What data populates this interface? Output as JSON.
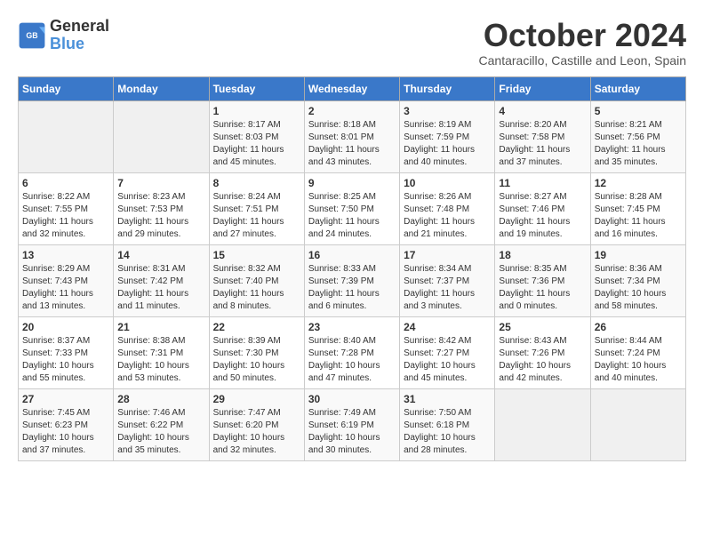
{
  "header": {
    "logo_line1": "General",
    "logo_line2": "Blue",
    "month_title": "October 2024",
    "location": "Cantaracillo, Castille and Leon, Spain"
  },
  "days_of_week": [
    "Sunday",
    "Monday",
    "Tuesday",
    "Wednesday",
    "Thursday",
    "Friday",
    "Saturday"
  ],
  "weeks": [
    [
      {
        "num": "",
        "info": ""
      },
      {
        "num": "",
        "info": ""
      },
      {
        "num": "1",
        "info": "Sunrise: 8:17 AM\nSunset: 8:03 PM\nDaylight: 11 hours and 45 minutes."
      },
      {
        "num": "2",
        "info": "Sunrise: 8:18 AM\nSunset: 8:01 PM\nDaylight: 11 hours and 43 minutes."
      },
      {
        "num": "3",
        "info": "Sunrise: 8:19 AM\nSunset: 7:59 PM\nDaylight: 11 hours and 40 minutes."
      },
      {
        "num": "4",
        "info": "Sunrise: 8:20 AM\nSunset: 7:58 PM\nDaylight: 11 hours and 37 minutes."
      },
      {
        "num": "5",
        "info": "Sunrise: 8:21 AM\nSunset: 7:56 PM\nDaylight: 11 hours and 35 minutes."
      }
    ],
    [
      {
        "num": "6",
        "info": "Sunrise: 8:22 AM\nSunset: 7:55 PM\nDaylight: 11 hours and 32 minutes."
      },
      {
        "num": "7",
        "info": "Sunrise: 8:23 AM\nSunset: 7:53 PM\nDaylight: 11 hours and 29 minutes."
      },
      {
        "num": "8",
        "info": "Sunrise: 8:24 AM\nSunset: 7:51 PM\nDaylight: 11 hours and 27 minutes."
      },
      {
        "num": "9",
        "info": "Sunrise: 8:25 AM\nSunset: 7:50 PM\nDaylight: 11 hours and 24 minutes."
      },
      {
        "num": "10",
        "info": "Sunrise: 8:26 AM\nSunset: 7:48 PM\nDaylight: 11 hours and 21 minutes."
      },
      {
        "num": "11",
        "info": "Sunrise: 8:27 AM\nSunset: 7:46 PM\nDaylight: 11 hours and 19 minutes."
      },
      {
        "num": "12",
        "info": "Sunrise: 8:28 AM\nSunset: 7:45 PM\nDaylight: 11 hours and 16 minutes."
      }
    ],
    [
      {
        "num": "13",
        "info": "Sunrise: 8:29 AM\nSunset: 7:43 PM\nDaylight: 11 hours and 13 minutes."
      },
      {
        "num": "14",
        "info": "Sunrise: 8:31 AM\nSunset: 7:42 PM\nDaylight: 11 hours and 11 minutes."
      },
      {
        "num": "15",
        "info": "Sunrise: 8:32 AM\nSunset: 7:40 PM\nDaylight: 11 hours and 8 minutes."
      },
      {
        "num": "16",
        "info": "Sunrise: 8:33 AM\nSunset: 7:39 PM\nDaylight: 11 hours and 6 minutes."
      },
      {
        "num": "17",
        "info": "Sunrise: 8:34 AM\nSunset: 7:37 PM\nDaylight: 11 hours and 3 minutes."
      },
      {
        "num": "18",
        "info": "Sunrise: 8:35 AM\nSunset: 7:36 PM\nDaylight: 11 hours and 0 minutes."
      },
      {
        "num": "19",
        "info": "Sunrise: 8:36 AM\nSunset: 7:34 PM\nDaylight: 10 hours and 58 minutes."
      }
    ],
    [
      {
        "num": "20",
        "info": "Sunrise: 8:37 AM\nSunset: 7:33 PM\nDaylight: 10 hours and 55 minutes."
      },
      {
        "num": "21",
        "info": "Sunrise: 8:38 AM\nSunset: 7:31 PM\nDaylight: 10 hours and 53 minutes."
      },
      {
        "num": "22",
        "info": "Sunrise: 8:39 AM\nSunset: 7:30 PM\nDaylight: 10 hours and 50 minutes."
      },
      {
        "num": "23",
        "info": "Sunrise: 8:40 AM\nSunset: 7:28 PM\nDaylight: 10 hours and 47 minutes."
      },
      {
        "num": "24",
        "info": "Sunrise: 8:42 AM\nSunset: 7:27 PM\nDaylight: 10 hours and 45 minutes."
      },
      {
        "num": "25",
        "info": "Sunrise: 8:43 AM\nSunset: 7:26 PM\nDaylight: 10 hours and 42 minutes."
      },
      {
        "num": "26",
        "info": "Sunrise: 8:44 AM\nSunset: 7:24 PM\nDaylight: 10 hours and 40 minutes."
      }
    ],
    [
      {
        "num": "27",
        "info": "Sunrise: 7:45 AM\nSunset: 6:23 PM\nDaylight: 10 hours and 37 minutes."
      },
      {
        "num": "28",
        "info": "Sunrise: 7:46 AM\nSunset: 6:22 PM\nDaylight: 10 hours and 35 minutes."
      },
      {
        "num": "29",
        "info": "Sunrise: 7:47 AM\nSunset: 6:20 PM\nDaylight: 10 hours and 32 minutes."
      },
      {
        "num": "30",
        "info": "Sunrise: 7:49 AM\nSunset: 6:19 PM\nDaylight: 10 hours and 30 minutes."
      },
      {
        "num": "31",
        "info": "Sunrise: 7:50 AM\nSunset: 6:18 PM\nDaylight: 10 hours and 28 minutes."
      },
      {
        "num": "",
        "info": ""
      },
      {
        "num": "",
        "info": ""
      }
    ]
  ]
}
